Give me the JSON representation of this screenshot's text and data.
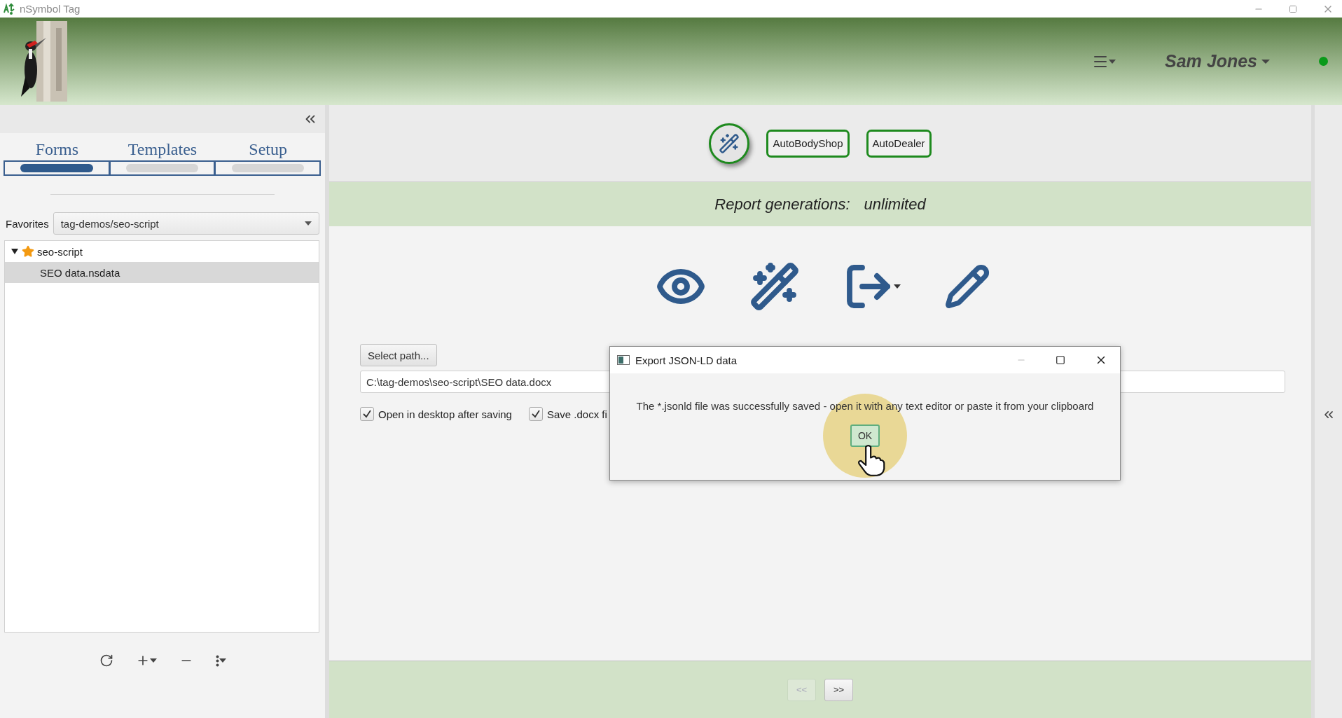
{
  "app_title": "nSymbol Tag",
  "header": {
    "user": "Sam Jones",
    "online": true
  },
  "sidebar": {
    "tabs": [
      {
        "label": "Forms",
        "selected": true
      },
      {
        "label": "Templates",
        "selected": false
      },
      {
        "label": "Setup",
        "selected": false
      }
    ],
    "favorites": {
      "label": "Favorites",
      "value": "tag-demos/seo-script"
    },
    "tree": [
      {
        "label": "seo-script",
        "favorite": true,
        "expanded": true,
        "selected": false,
        "children": [
          {
            "label": "SEO data.nsdata",
            "favorite": false,
            "selected": true
          }
        ]
      }
    ]
  },
  "toolbar": {
    "templates": [
      "AutoBodyShop",
      "AutoDealer"
    ]
  },
  "report": {
    "label": "Report generations:",
    "value": "unlimited"
  },
  "export": {
    "select_path": "Select path...",
    "path": "C:\\tag-demos\\seo-script\\SEO data.docx",
    "options": [
      {
        "label": "Open in desktop after saving",
        "checked": true
      },
      {
        "label": "Save .docx fi",
        "checked": true
      }
    ]
  },
  "pager": [
    {
      "label": "<<",
      "disabled": true
    },
    {
      "label": ">>",
      "disabled": false
    }
  ],
  "dialog": {
    "title": "Export JSON-LD data",
    "message": "The *.jsonld file was successfully saved - open it with any text editor or paste it from your clipboard",
    "ok": "OK"
  }
}
